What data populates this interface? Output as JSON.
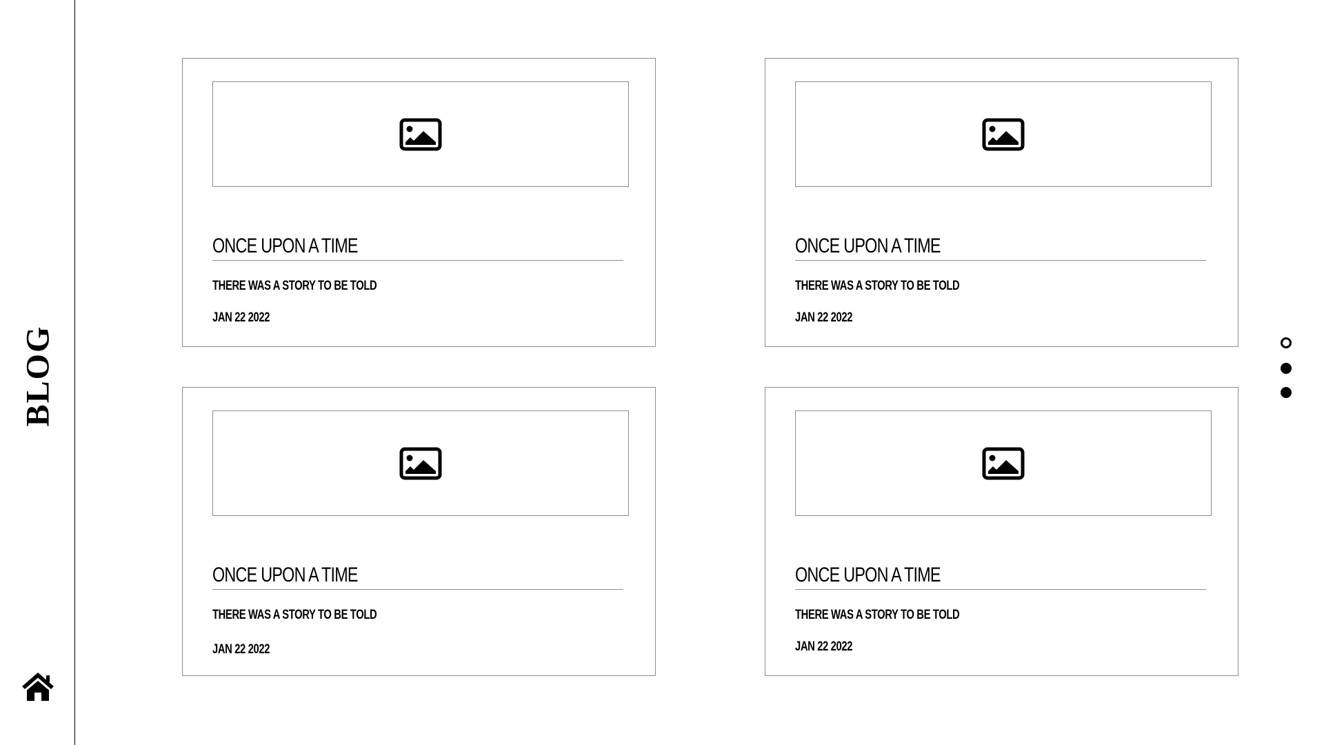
{
  "sidebar": {
    "brand": "BLOG",
    "home_icon": "home-icon"
  },
  "cards": [
    {
      "image_icon": "image-icon",
      "title": "ONCE UPON A TIME",
      "subtitle": "THERE WAS A STORY TO BE TOLD",
      "date": "JAN 22 2022"
    },
    {
      "image_icon": "image-icon",
      "title": "ONCE UPON A TIME",
      "subtitle": "THERE WAS A STORY TO BE TOLD",
      "date": "JAN 22 2022"
    },
    {
      "image_icon": "image-icon",
      "title": "ONCE UPON A TIME",
      "subtitle": "THERE WAS A STORY TO BE TOLD",
      "date": "JAN 22 2022"
    },
    {
      "image_icon": "image-icon",
      "title": "ONCE UPON A TIME",
      "subtitle": "THERE WAS A STORY TO BE TOLD",
      "date": "JAN 22 2022"
    }
  ],
  "pagination": {
    "dots": [
      {
        "state": "active-outline"
      },
      {
        "state": "filled"
      },
      {
        "state": "filled"
      }
    ]
  },
  "colors": {
    "background": "#ffffff",
    "text": "#000000",
    "border": "#8c8c8c"
  }
}
